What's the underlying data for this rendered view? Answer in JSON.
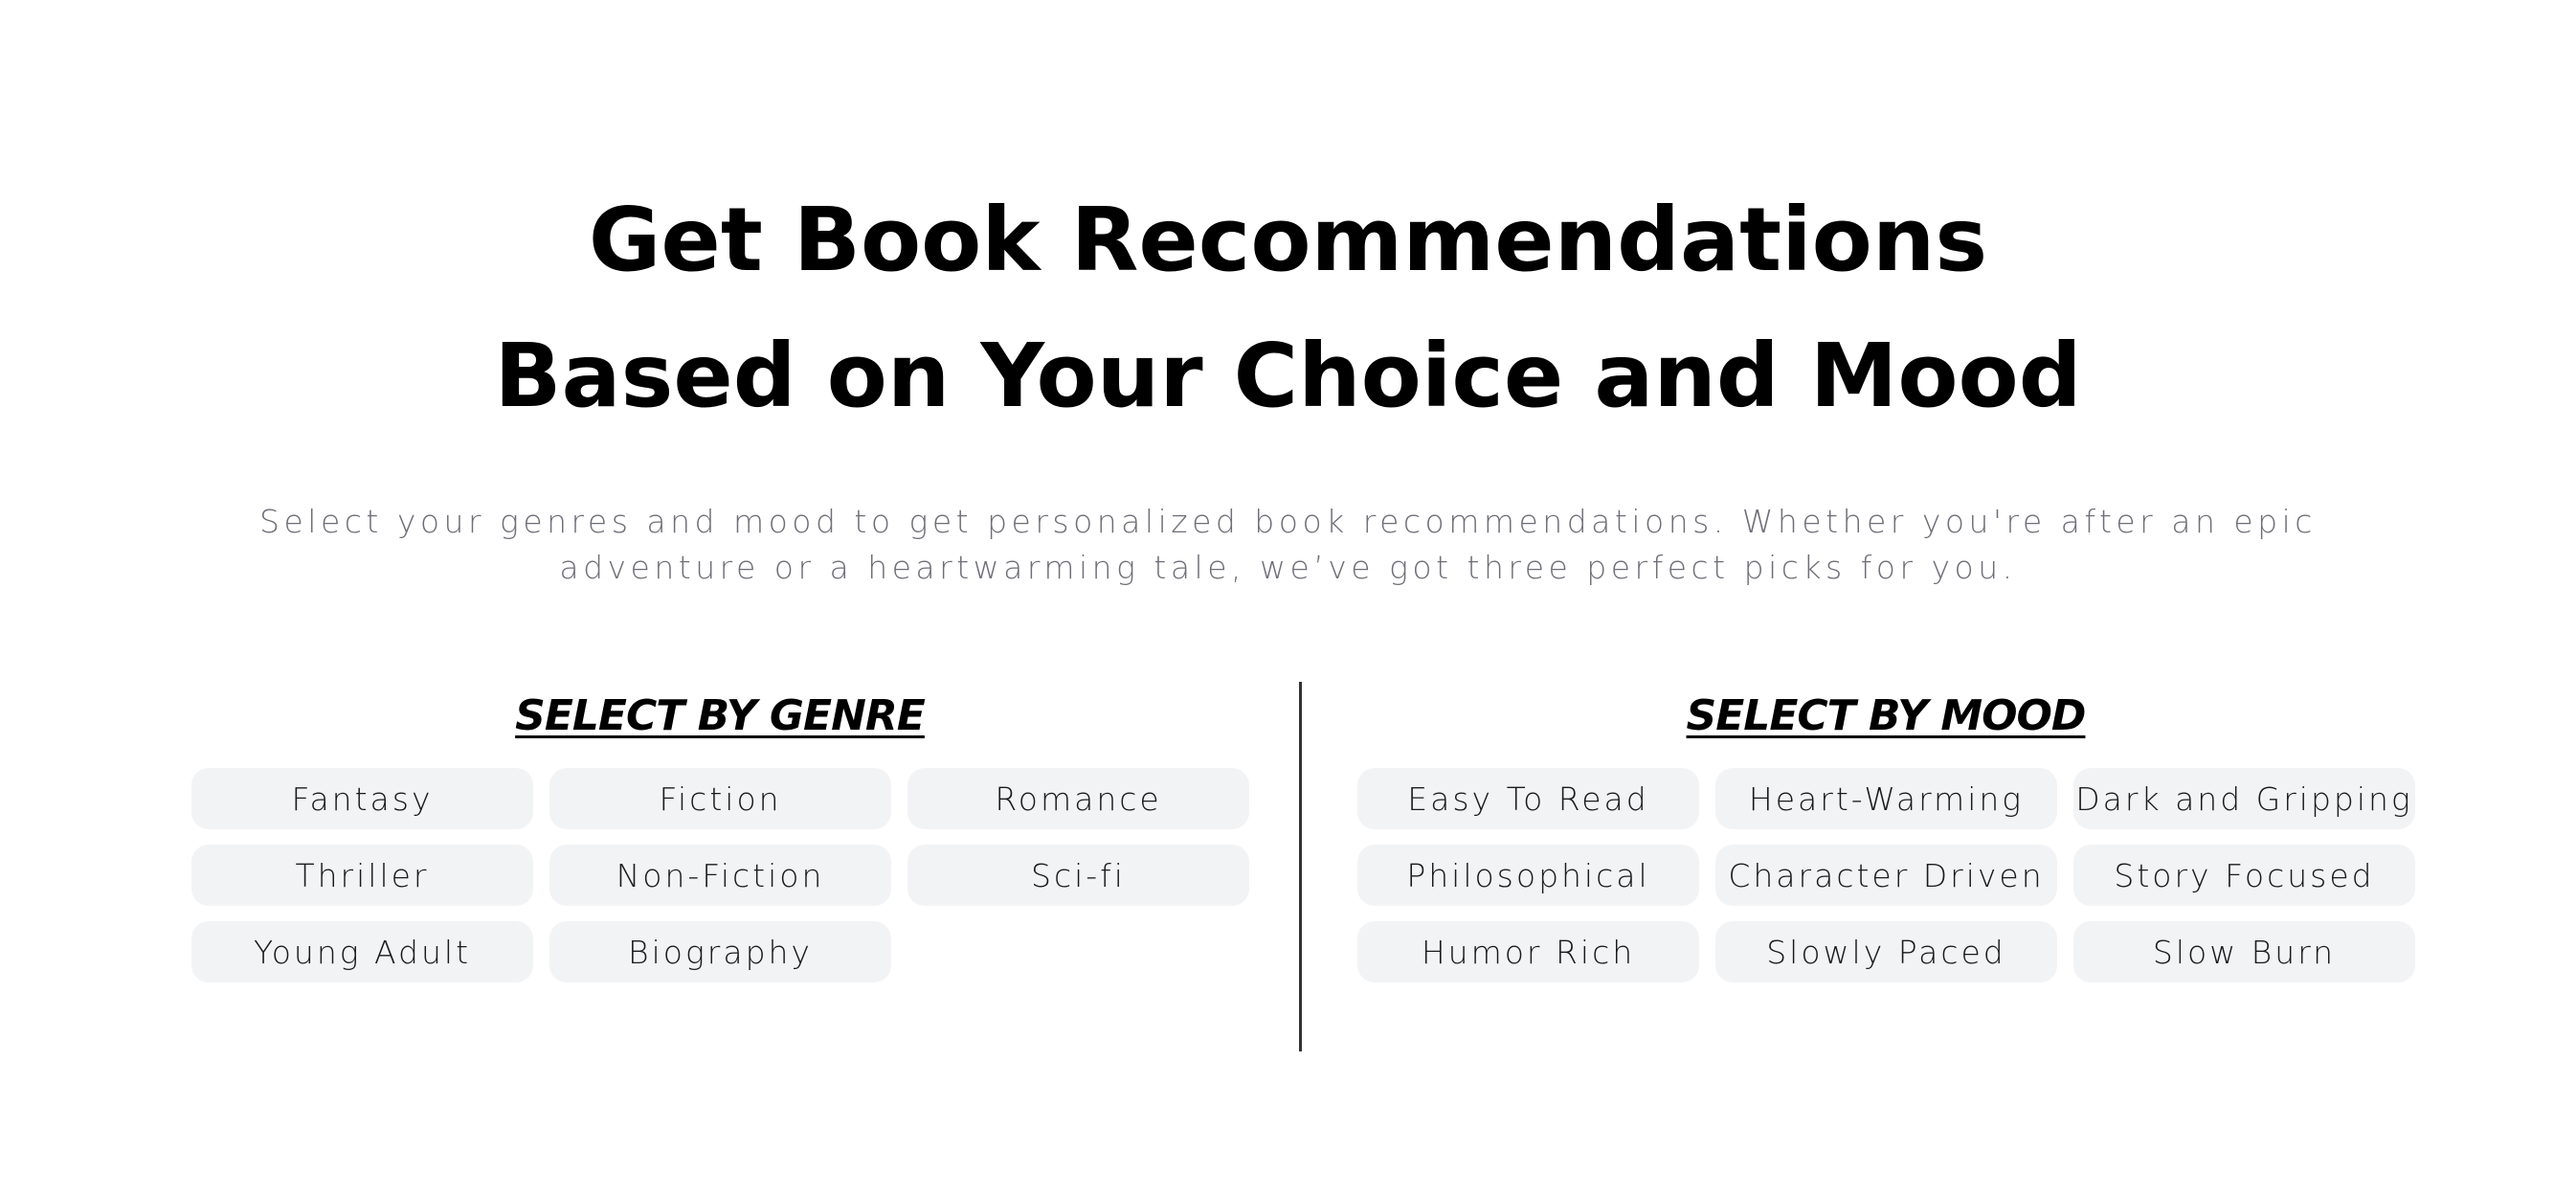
{
  "hero": {
    "title_line1": "Get Book Recommendations",
    "title_line2": "Based on Your Choice and Mood",
    "subtitle": "Select your genres and mood to get personalized book recommendations. Whether you're after an epic adventure or a heartwarming tale, we’ve got three perfect picks for you."
  },
  "genre": {
    "title": "SELECT BY GENRE",
    "options": [
      "Fantasy",
      "Fiction",
      "Romance",
      "Thriller",
      "Non-Fiction",
      "Sci-fi",
      "Young Adult",
      "Biography"
    ]
  },
  "mood": {
    "title": "SELECT BY MOOD",
    "options": [
      "Easy To Read",
      "Heart-Warming",
      "Dark and Gripping",
      "Philosophical",
      "Character Driven",
      "Story Focused",
      "Humor Rich",
      "Slowly Paced",
      "Slow Burn"
    ]
  },
  "colors": {
    "chip_background": "#f2f3f5",
    "subtitle_text": "#6e6e78",
    "divider": "#333333"
  }
}
